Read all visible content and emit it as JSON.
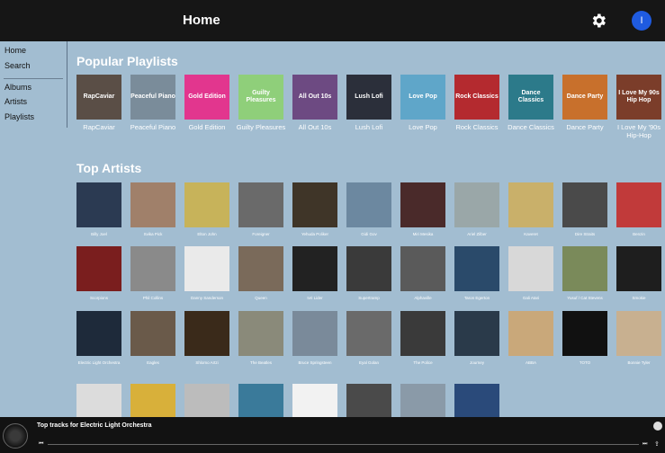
{
  "header": {
    "title": "Home",
    "avatar_initial": "I"
  },
  "sidebar": {
    "items": [
      {
        "label": "Home"
      },
      {
        "label": "Search"
      },
      {
        "label": "Albums"
      },
      {
        "label": "Artists"
      },
      {
        "label": "Playlists"
      }
    ]
  },
  "playlists": {
    "title": "Popular Playlists",
    "items": [
      {
        "label": "RapCaviar",
        "cover_text": "RapCaviar",
        "color": "#5a4e46"
      },
      {
        "label": "Peaceful Piano",
        "cover_text": "Peaceful Piano",
        "color": "#7a8c9a"
      },
      {
        "label": "Gold Edition",
        "cover_text": "Gold Edition",
        "color": "#e2368e"
      },
      {
        "label": "Guilty Pleasures",
        "cover_text": "Guilty Pleasures",
        "color": "#8fcf7a"
      },
      {
        "label": "All Out 10s",
        "cover_text": "All Out 10s",
        "color": "#6d4a82"
      },
      {
        "label": "Lush Lofi",
        "cover_text": "Lush Lofi",
        "color": "#2b2f3a"
      },
      {
        "label": "Love Pop",
        "cover_text": "Love Pop",
        "color": "#5fa6c9"
      },
      {
        "label": "Rock Classics",
        "cover_text": "Rock Classics",
        "color": "#b42a2f"
      },
      {
        "label": "Dance Classics",
        "cover_text": "Dance Classics",
        "color": "#2c7a8a"
      },
      {
        "label": "Dance Party",
        "cover_text": "Dance Party",
        "color": "#c8702c"
      },
      {
        "label": "I Love My '90s Hip-Hop",
        "cover_text": "I Love My 90s Hip Hop",
        "color": "#7b3d2a"
      }
    ]
  },
  "artists": {
    "title": "Top Artists",
    "items": [
      {
        "label": "Billy Joel",
        "color": "#2b3a52"
      },
      {
        "label": "Svika Pick",
        "color": "#a0806a"
      },
      {
        "label": "Elton John",
        "color": "#c7b35a"
      },
      {
        "label": "Foreigner",
        "color": "#6a6a6a"
      },
      {
        "label": "Yehuda Poliker",
        "color": "#3f3528"
      },
      {
        "label": "Gidi Gov",
        "color": "#6c88a0"
      },
      {
        "label": "Miri Mesika",
        "color": "#4a2a2a"
      },
      {
        "label": "Ariel Zilber",
        "color": "#9aa7a8"
      },
      {
        "label": "Kaveret",
        "color": "#c9b06a"
      },
      {
        "label": "Dire Straits",
        "color": "#4a4a4a"
      },
      {
        "label": "Benzin",
        "color": "#c13a3a"
      },
      {
        "label": "Scorpions",
        "color": "#7a1e1e"
      },
      {
        "label": "Phil Collins",
        "color": "#8a8a8a"
      },
      {
        "label": "Danny Sanderson",
        "color": "#eaeaea"
      },
      {
        "label": "Queen",
        "color": "#7a6a5a"
      },
      {
        "label": "Ivri Lider",
        "color": "#222222"
      },
      {
        "label": "Supertramp",
        "color": "#3a3a3a"
      },
      {
        "label": "Alphaville",
        "color": "#5a5a5a"
      },
      {
        "label": "Taron Egerton",
        "color": "#2a4a6a"
      },
      {
        "label": "Gali Atari",
        "color": "#d8d8d8"
      },
      {
        "label": "Yusuf / Cat Stevens",
        "color": "#7a8a5a"
      },
      {
        "label": "Smokie",
        "color": "#1e1e1e"
      },
      {
        "label": "Electric Light Orchestra",
        "color": "#1e2a3a"
      },
      {
        "label": "Eagles",
        "color": "#6a5a4a"
      },
      {
        "label": "Shlomo Artzi",
        "color": "#3a2a1a"
      },
      {
        "label": "The Beatles",
        "color": "#8a8a7a"
      },
      {
        "label": "Bruce Springsteen",
        "color": "#7a8a9a"
      },
      {
        "label": "Eyal Golan",
        "color": "#6a6a6a"
      },
      {
        "label": "The Police",
        "color": "#3a3a3a"
      },
      {
        "label": "Journey",
        "color": "#2a3a4a"
      },
      {
        "label": "ABBA",
        "color": "#c9a87a"
      },
      {
        "label": "TOTO",
        "color": "#111111"
      },
      {
        "label": "Bonnie Tyler",
        "color": "#c8b090"
      },
      {
        "label": "",
        "color": "#dcdcdc"
      },
      {
        "label": "",
        "color": "#d8b03a"
      },
      {
        "label": "",
        "color": "#bcbcbc"
      },
      {
        "label": "",
        "color": "#3a7a9a"
      },
      {
        "label": "",
        "color": "#f2f2f2"
      },
      {
        "label": "",
        "color": "#4a4a4a"
      },
      {
        "label": "",
        "color": "#8a9aa8"
      },
      {
        "label": "",
        "color": "#2a4a7a"
      }
    ]
  },
  "player": {
    "track_title": "Top tracks for Electric Light Orchestra"
  }
}
